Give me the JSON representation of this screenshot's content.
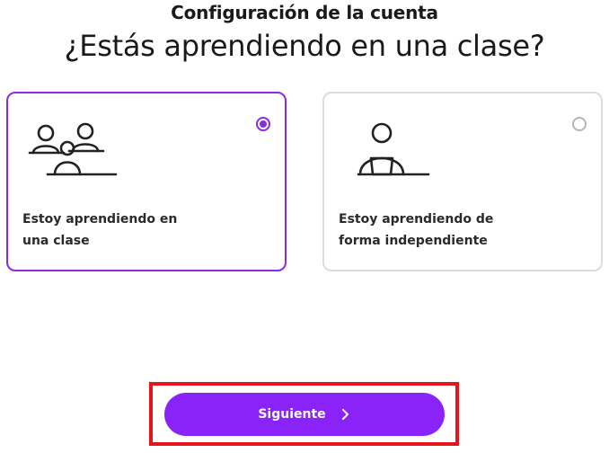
{
  "header": {
    "kicker": "Configuración de la cuenta",
    "title": "¿Estás aprendiendo en una clase?"
  },
  "options": [
    {
      "label": "Estoy aprendiendo en una clase",
      "selected": true,
      "icon": "classroom-group-icon"
    },
    {
      "label": "Estoy aprendiendo de forma independiente",
      "selected": false,
      "icon": "independent-learner-icon"
    }
  ],
  "footer": {
    "next_label": "Siguiente",
    "next_icon": "chevron-right-icon"
  },
  "colors": {
    "accent": "#8a23f8",
    "selected_border": "#8a2be2",
    "highlight": "#e8141c"
  }
}
